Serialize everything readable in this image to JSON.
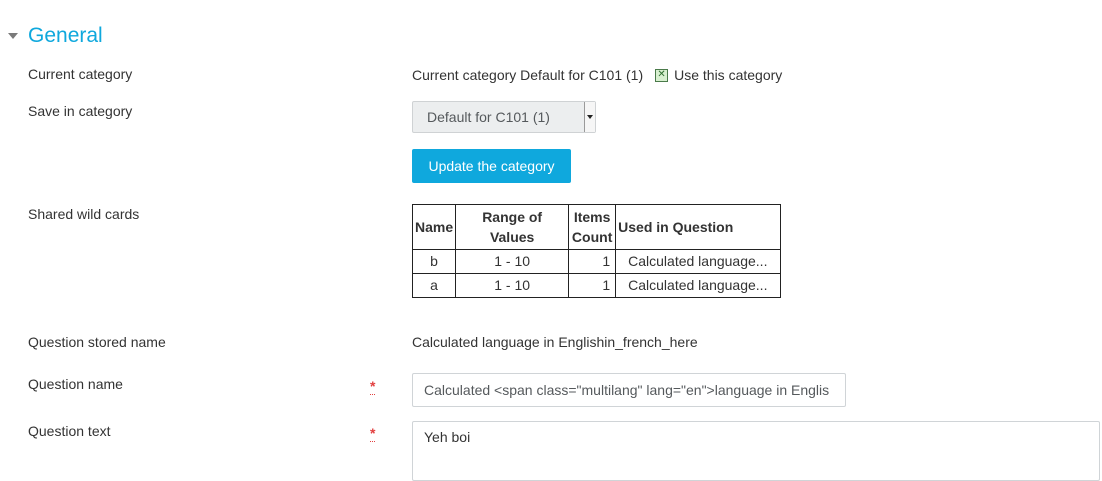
{
  "section": {
    "title": "General"
  },
  "current_category": {
    "label": "Current category",
    "value": "Current category Default for C101 (1)",
    "checkbox_label": "Use this category"
  },
  "save_in_category": {
    "label": "Save in category",
    "selected": "Default for C101 (1)",
    "update_button": "Update the category"
  },
  "shared_wild_cards": {
    "label": "Shared wild cards",
    "headers": {
      "name": "Name",
      "range": "Range of Values",
      "items_line1": "Items",
      "items_line2": "Count",
      "used": "Used in Question"
    },
    "rows": [
      {
        "name": "b",
        "range": "1 - 10",
        "count": "1",
        "used": "Calculated language..."
      },
      {
        "name": "a",
        "range": "1 - 10",
        "count": "1",
        "used": "Calculated language..."
      }
    ]
  },
  "question_stored_name": {
    "label": "Question stored name",
    "value": "Calculated language in Englishin_french_here"
  },
  "question_name": {
    "label": "Question name",
    "value": "Calculated <span class=\"multilang\" lang=\"en\">language in Englis"
  },
  "question_text": {
    "label": "Question text",
    "value": "Yeh boi"
  },
  "colors": {
    "accent": "#0fa8dd",
    "required": "#e23f3f"
  }
}
